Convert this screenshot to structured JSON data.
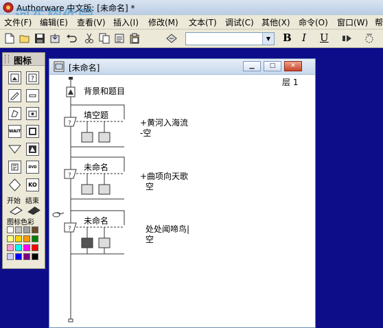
{
  "app": {
    "title": "Authorware 中文版: [未命名] *",
    "watermark": "河东软件园",
    "watermark_url": "www.pc0359.cn"
  },
  "menu": [
    "文件(F)",
    "编辑(E)",
    "查看(V)",
    "插入(I)",
    "修改(M)",
    "文本(T)",
    "调试(C)",
    "其他(X)",
    "命令(O)",
    "窗口(W)",
    "帮"
  ],
  "toolbar": {
    "buttons": [
      "new-icon",
      "open-icon",
      "save-all-icon",
      "import-icon",
      "undo-icon",
      "cut-icon",
      "copy-icon",
      "paste-icon",
      "find-icon"
    ],
    "font_combo_value": "",
    "bold": "B",
    "italic": "I",
    "underline": "U",
    "run": "run-icon",
    "control": "control-panel-icon"
  },
  "palette": {
    "title": "图标",
    "start_label": "开始",
    "end_label": "结束",
    "color_label": "图标色彩",
    "icons": [
      "display-icon",
      "motion-icon",
      "erase-icon",
      "wait-icon",
      "navigate-icon",
      "framework-icon",
      "decision-icon",
      "interaction-icon",
      "calculation-icon",
      "map-icon",
      "digital-movie-icon",
      "audio-icon",
      "dvd-icon",
      "knowledge-object-icon"
    ],
    "colors": [
      "#ffffff",
      "#c0c0c0",
      "#a0a0a0",
      "#6a4a2a",
      "#ffff80",
      "#ffd700",
      "#ff9900",
      "#008000",
      "#ff99cc",
      "#00ffff",
      "#ff00ff",
      "#ff0000",
      "#ccccff",
      "#0000ff",
      "#800080",
      "#000000"
    ]
  },
  "flow_window": {
    "title": "[未命名]",
    "level": "层 1",
    "controls": [
      "minimize",
      "maximize",
      "close"
    ],
    "items": [
      {
        "name": "背景和题目",
        "type": "display"
      },
      {
        "name": "填空题",
        "type": "interaction",
        "responses": [
          "+黄河入海流",
          "-空"
        ]
      },
      {
        "name": "未命名",
        "type": "interaction",
        "responses": [
          "+曲项向天歌",
          "空"
        ]
      },
      {
        "name": "未命名",
        "type": "interaction",
        "responses": [
          "处处闻啼鸟|",
          "空"
        ]
      }
    ]
  }
}
